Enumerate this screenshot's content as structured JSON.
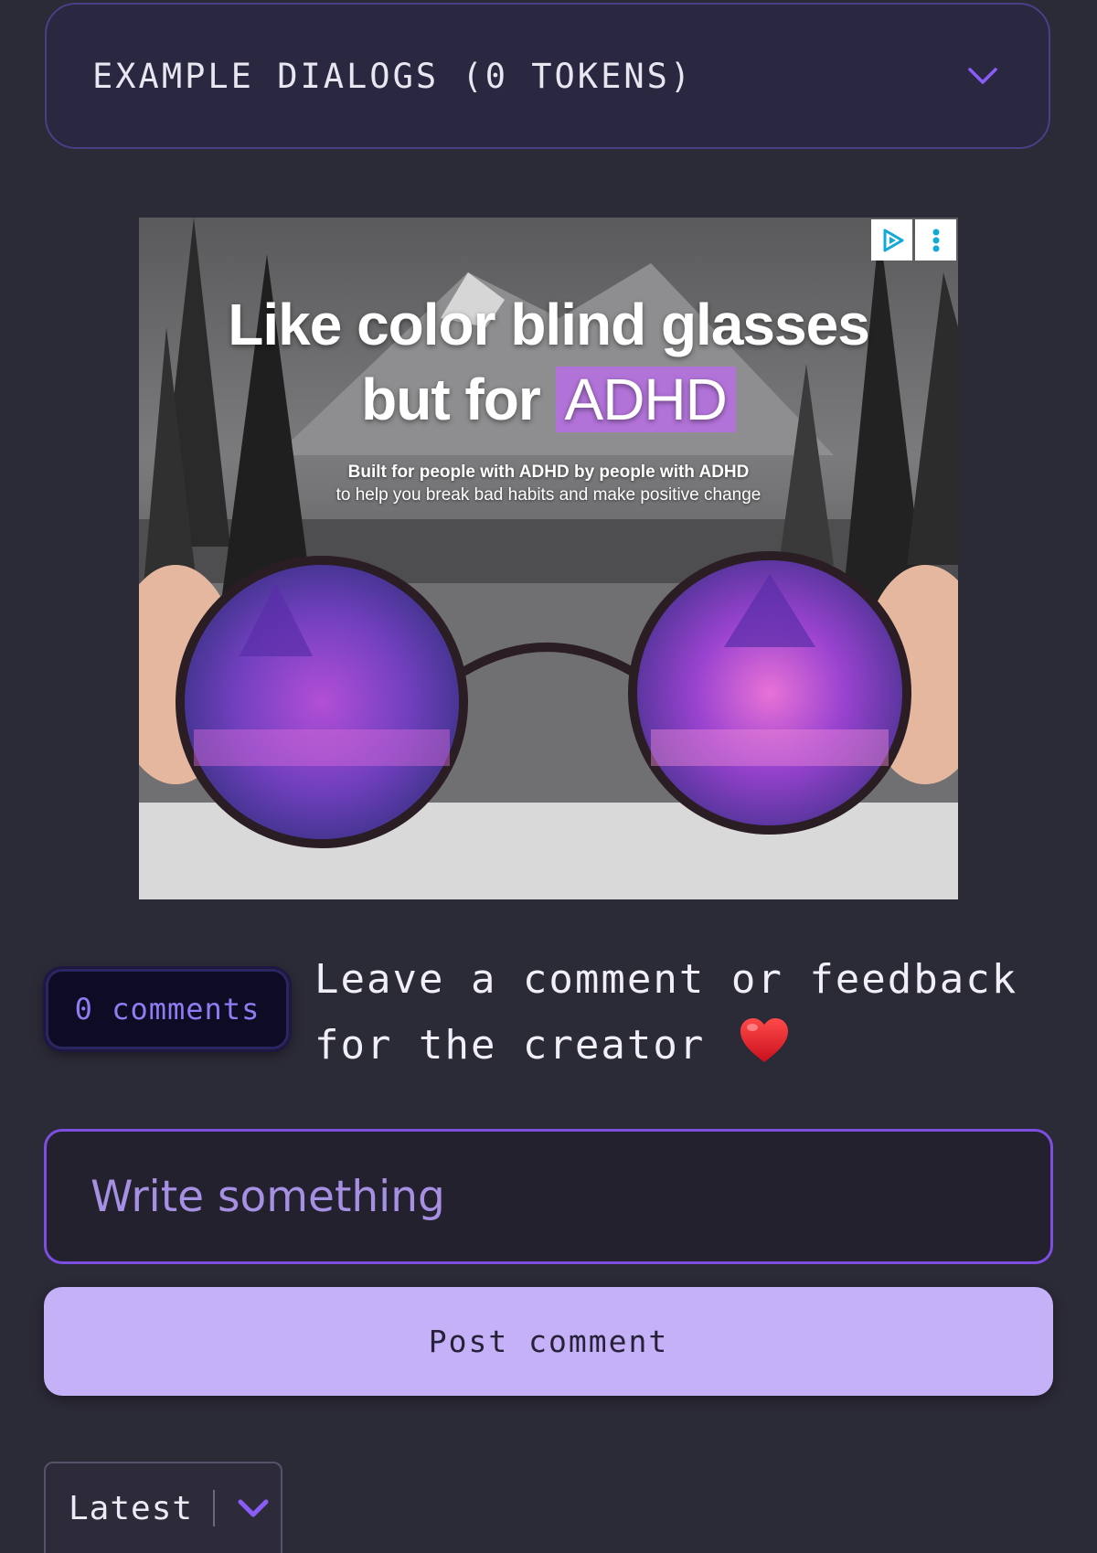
{
  "accordion": {
    "title": "EXAMPLE DIALOGS (0 TOKENS)",
    "icon": "chevron-down-icon"
  },
  "ad": {
    "headline_line1": "Like color blind glasses",
    "headline_line2_prefix": "but for",
    "headline_highlight": "ADHD",
    "subline1": "Built for people with ADHD by people with ADHD",
    "subline2": "to help you break bad habits and make positive change",
    "highlight_color": "#b273d9",
    "badges": [
      "adchoices-icon",
      "more-vertical-icon"
    ]
  },
  "comments": {
    "count_label": "0 comments",
    "hint_text": "Leave a comment or feedback for the creator",
    "hint_icon": "heart-icon",
    "input_placeholder": "Write something",
    "post_button_label": "Post comment",
    "sort_selected": "Latest",
    "accent_color": "#7d4ee0",
    "button_color": "#c5b1f7"
  }
}
